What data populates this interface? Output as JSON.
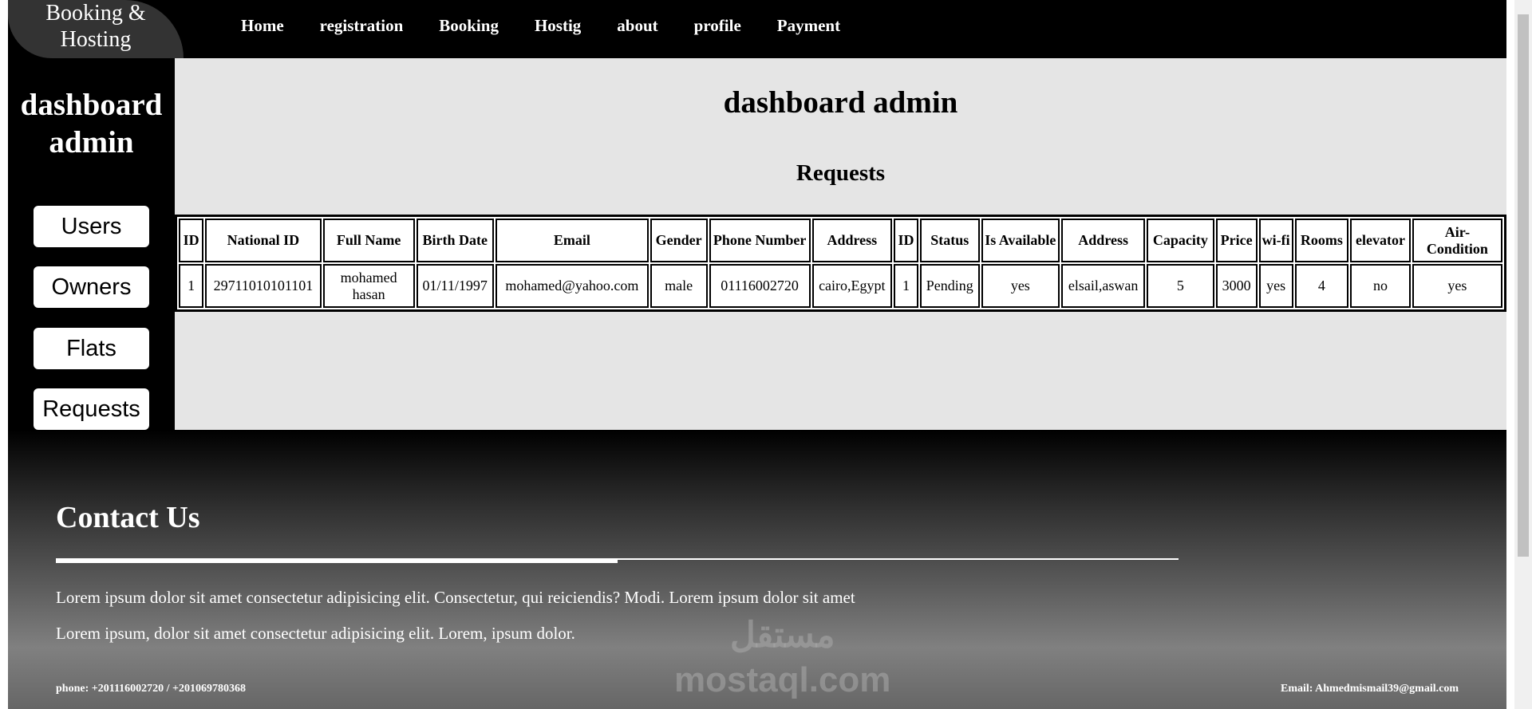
{
  "header": {
    "logo": "Booking & Hosting",
    "nav": [
      "Home",
      "registration",
      "Booking",
      "Hostig",
      "about",
      "profile",
      "Payment"
    ]
  },
  "sidebar": {
    "title": "dashboard admin",
    "buttons": [
      "Users",
      "Owners",
      "Flats",
      "Requests"
    ]
  },
  "main": {
    "title": "dashboard admin",
    "section": "Requests",
    "columns": [
      "ID",
      "National ID",
      "Full Name",
      "Birth Date",
      "Email",
      "Gender",
      "Phone Number",
      "Address",
      "ID",
      "Status",
      "Is Available",
      "Address",
      "Capacity",
      "Price",
      "wi-fi",
      "Rooms",
      "elevator",
      "Air-Condition"
    ],
    "rows": [
      [
        "1",
        "29711010101101",
        "mohamed hasan",
        "01/11/1997",
        "mohamed@yahoo.com",
        "male",
        "01116002720",
        "cairo,Egypt",
        "1",
        "Pending",
        "yes",
        "elsail,aswan",
        "5",
        "3000",
        "yes",
        "4",
        "no",
        "yes"
      ]
    ]
  },
  "footer": {
    "title": "Contact Us",
    "lines": [
      "Lorem ipsum dolor sit amet consectetur adipisicing elit. Consectetur, qui reiciendis? Modi. Lorem ipsum dolor sit amet",
      "Lorem ipsum, dolor sit amet consectetur adipisicing elit. Lorem, ipsum dolor."
    ],
    "phone": "phone: +201116002720 / +201069780368",
    "email": "Email: Ahmedmismail39@gmail.com"
  },
  "watermark": {
    "arabic": "مستقل",
    "latin": "mostaql.com"
  }
}
